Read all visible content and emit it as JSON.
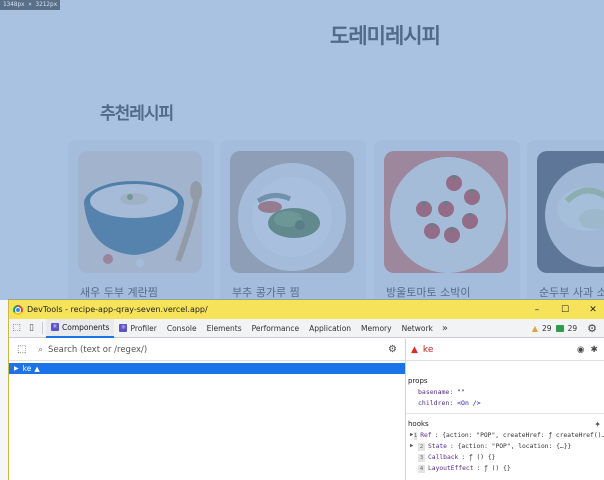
{
  "site": {
    "size_badge": "1348px × 3212px",
    "title": "도레미레시피",
    "section_title": "추천레시피",
    "cards": [
      {
        "name": "새우 두부 계란찜",
        "icon": "food-photo"
      },
      {
        "name": "부추 콩가루 찜",
        "icon": "food-photo"
      },
      {
        "name": "방울토마토 소박이",
        "icon": "food-photo"
      },
      {
        "name": "순두부 사과 소",
        "icon": "food-photo"
      }
    ],
    "overlay_color": "#6d96cc"
  },
  "devtools": {
    "window_title": "DevTools - recipe-app-qray-seven.vercel.app/",
    "window_buttons": {
      "minimize": "–",
      "maximize": "☐",
      "close": "✕"
    },
    "tabs": [
      {
        "label": "Components",
        "active": true
      },
      {
        "label": "Profiler",
        "active": false
      },
      {
        "label": "Console",
        "active": false
      },
      {
        "label": "Elements",
        "active": false
      },
      {
        "label": "Performance",
        "active": false
      },
      {
        "label": "Application",
        "active": false
      },
      {
        "label": "Memory",
        "active": false
      },
      {
        "label": "Network",
        "active": false
      }
    ],
    "more_tabs": "»",
    "warning_count": "29",
    "message_count": "29",
    "search": {
      "placeholder": "Search (text or /regex/)",
      "value": ""
    },
    "tree": {
      "selected_component": "ke"
    },
    "inspector": {
      "component_name": "ke",
      "props_label": "props",
      "props": [
        {
          "key": "basename",
          "value": "\"\""
        },
        {
          "key": "children",
          "value": "<On />"
        }
      ],
      "hooks_label": "hooks",
      "hooks": [
        {
          "index": "1",
          "name": "Ref",
          "value": "{action: \"POP\", createHref: ƒ createHref()…}",
          "expandable": true
        },
        {
          "index": "2",
          "name": "State",
          "value": "{action: \"POP\", location: {…}}",
          "expandable": true
        },
        {
          "index": "3",
          "name": "Callback",
          "value": "ƒ () {}",
          "expandable": false
        },
        {
          "index": "4",
          "name": "LayoutEffect",
          "value": "ƒ () {}",
          "expandable": false
        }
      ]
    }
  }
}
